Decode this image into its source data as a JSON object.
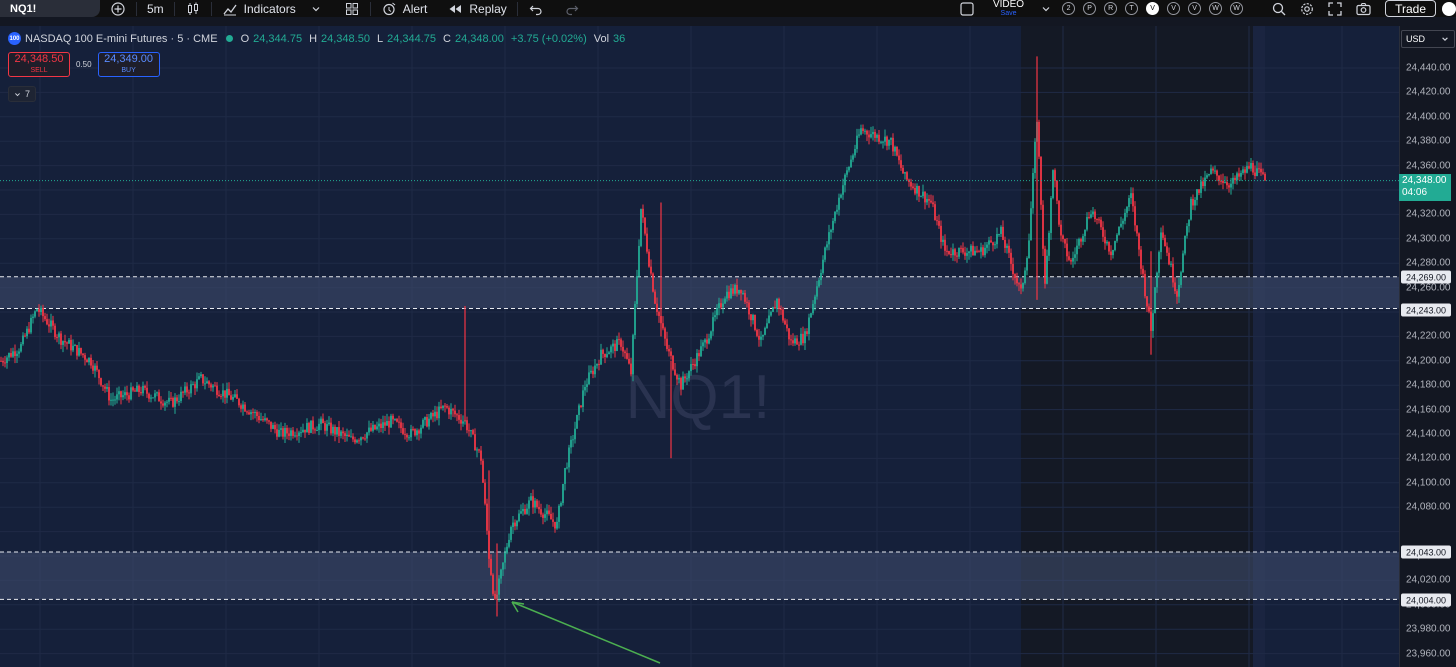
{
  "toolbar": {
    "symbol": "NQ1!",
    "interval": "5m",
    "indicators_label": "Indicators",
    "alert_label": "Alert",
    "replay_label": "Replay",
    "video_label": "VIDEO",
    "video_sub": "Save",
    "quick_buttons": [
      "2",
      "P",
      "R",
      "T",
      "V",
      "V",
      "V",
      "W",
      "W"
    ],
    "trade_label": "Trade"
  },
  "legend": {
    "badge": "100",
    "title": "NASDAQ 100 E-mini Futures · 5 · CME",
    "open_key": "O",
    "open": "24,344.75",
    "high_key": "H",
    "high": "24,348.50",
    "low_key": "L",
    "low": "24,344.75",
    "close_key": "C",
    "close": "24,348.00",
    "change": "+3.75 (+0.02%)",
    "vol_key": "Vol",
    "vol": "36"
  },
  "order_panel": {
    "sell_price": "24,348.50",
    "sell_label": "SELL",
    "spread": "0.50",
    "buy_price": "24,349.00",
    "buy_label": "BUY"
  },
  "indicator_toggle": {
    "count": "7"
  },
  "watermark": "NQ1!",
  "currency": "USD",
  "price_axis": {
    "ticks": [
      "24,440.00",
      "24,420.00",
      "24,400.00",
      "24,380.00",
      "24,360.00",
      "24,320.00",
      "24,300.00",
      "24,280.00",
      "24,260.00",
      "24,220.00",
      "24,200.00",
      "24,180.00",
      "24,160.00",
      "24,140.00",
      "24,120.00",
      "24,100.00",
      "24,080.00",
      "24,060.00",
      "24,020.00",
      "24,000.00",
      "23,980.00",
      "23,960.00"
    ],
    "last_price": "24,348.00",
    "countdown": "04:06"
  },
  "zones": [
    {
      "upper_label": "24,269.00",
      "lower_label": "24,243.00"
    },
    {
      "upper_label": "24,043.00",
      "lower_label": "24,004.00"
    }
  ],
  "colors": {
    "up": "#22ab94",
    "down": "#f23645",
    "background": "#131722",
    "session_bg": "#15203a",
    "zone_fill": "#3d4b6b",
    "arrow": "#4caf50"
  }
}
